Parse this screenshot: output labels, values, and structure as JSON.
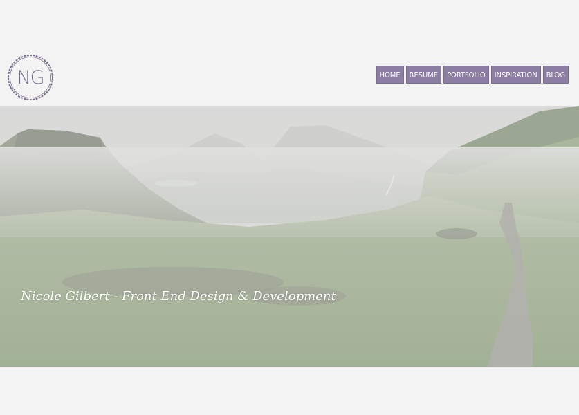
{
  "logo": {
    "initials": "NG"
  },
  "nav": {
    "items": [
      {
        "label": "HOME"
      },
      {
        "label": "RESUME"
      },
      {
        "label": "PORTFOLIO"
      },
      {
        "label": "INSPIRATION"
      },
      {
        "label": "BLOG"
      }
    ]
  },
  "hero": {
    "tagline": "Nicole Gilbert - Front End Design & Development"
  },
  "colors": {
    "background": "#f4f3f4",
    "accent": "#8c7ea3",
    "logo": "#7a6f8e"
  }
}
